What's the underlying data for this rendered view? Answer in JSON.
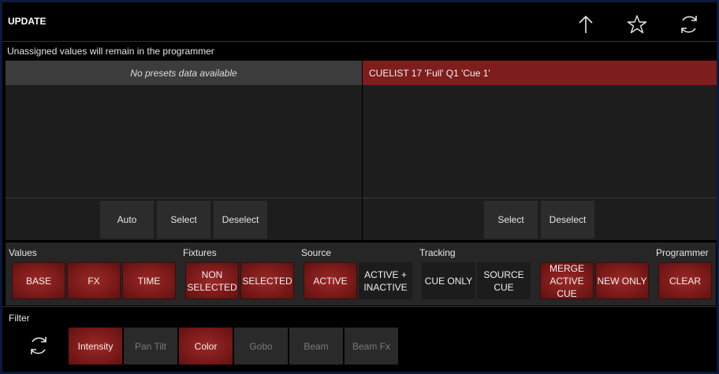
{
  "header": {
    "title": "UPDATE",
    "icons": [
      "up-arrow-icon",
      "star-icon",
      "refresh-icon"
    ]
  },
  "notice": "Unassigned values will remain in the programmer",
  "presets_panel": {
    "header": "No presets data available",
    "buttons": [
      "Auto",
      "Select",
      "Deselect"
    ]
  },
  "cuelist_panel": {
    "header": "CUELIST 17 'Full'   Q1 'Cue 1'",
    "buttons": [
      "Select",
      "Deselect"
    ]
  },
  "options": {
    "values": {
      "label": "Values",
      "buttons": [
        "BASE",
        "FX",
        "TIME"
      ]
    },
    "fixtures": {
      "label": "Fixtures",
      "buttons": [
        "NON SELECTED",
        "SELECTED"
      ]
    },
    "source": {
      "label": "Source",
      "buttons": [
        "ACTIVE",
        "ACTIVE + INACTIVE"
      ]
    },
    "tracking": {
      "label": "Tracking",
      "buttons": [
        "CUE ONLY",
        "SOURCE CUE"
      ]
    },
    "merge": {
      "buttons": [
        "MERGE ACTIVE CUE",
        "NEW ONLY"
      ]
    },
    "programmer": {
      "label": "Programmer",
      "buttons": [
        "CLEAR"
      ]
    }
  },
  "filter": {
    "label": "Filter",
    "items": [
      {
        "label": "Intensity",
        "active": true
      },
      {
        "label": "Pan Tilt",
        "active": false
      },
      {
        "label": "Color",
        "active": true
      },
      {
        "label": "Gobo",
        "active": false
      },
      {
        "label": "Beam",
        "active": false
      },
      {
        "label": "Beam Fx",
        "active": false
      }
    ]
  },
  "colors": {
    "accent_red": "#7d1d1c",
    "border_blue": "#0b1a3a",
    "background": "#000000"
  }
}
